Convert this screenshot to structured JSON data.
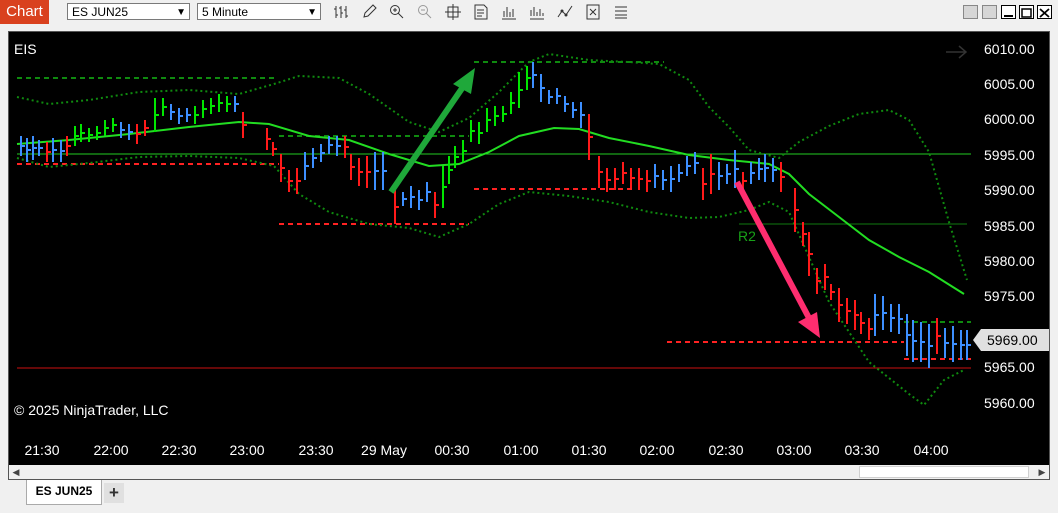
{
  "titlebar": {
    "app_label": "Chart",
    "instrument_select": "ES JUN25",
    "interval_select": "5 Minute",
    "tools": [
      "bar-type-icon",
      "drawing-pencil-icon",
      "zoom-in-icon",
      "zoom-out-icon",
      "crosshair-icon",
      "data-box-icon",
      "bar-chart-icon",
      "indicators-icon",
      "strategies-icon",
      "properties-icon"
    ]
  },
  "chart": {
    "instrument_label": "EIS",
    "copyright": "© 2025 NinjaTrader, LLC",
    "current_price": "5969.00",
    "pivot_label": "R2",
    "price_labels": [
      "6010.00",
      "6005.00",
      "6000.00",
      "5995.00",
      "5990.00",
      "5985.00",
      "5980.00",
      "5975.00",
      "5965.00",
      "5960.00"
    ],
    "time_labels": [
      "21:30",
      "22:00",
      "22:30",
      "23:00",
      "23:30",
      "29 May",
      "00:30",
      "01:00",
      "01:30",
      "02:00",
      "02:30",
      "03:00",
      "03:30",
      "04:00"
    ],
    "colors": {
      "up_bar": "#00e600",
      "down_bar": "#ff1a1a",
      "neutral_bar": "#3d8fff",
      "ma_line": "#22dd22",
      "band": "#0f8a0f",
      "green_arrow": "#1fa83a",
      "pink_arrow": "#ff2d6f"
    }
  },
  "tabs": {
    "active": "ES JUN25",
    "add": "+"
  }
}
